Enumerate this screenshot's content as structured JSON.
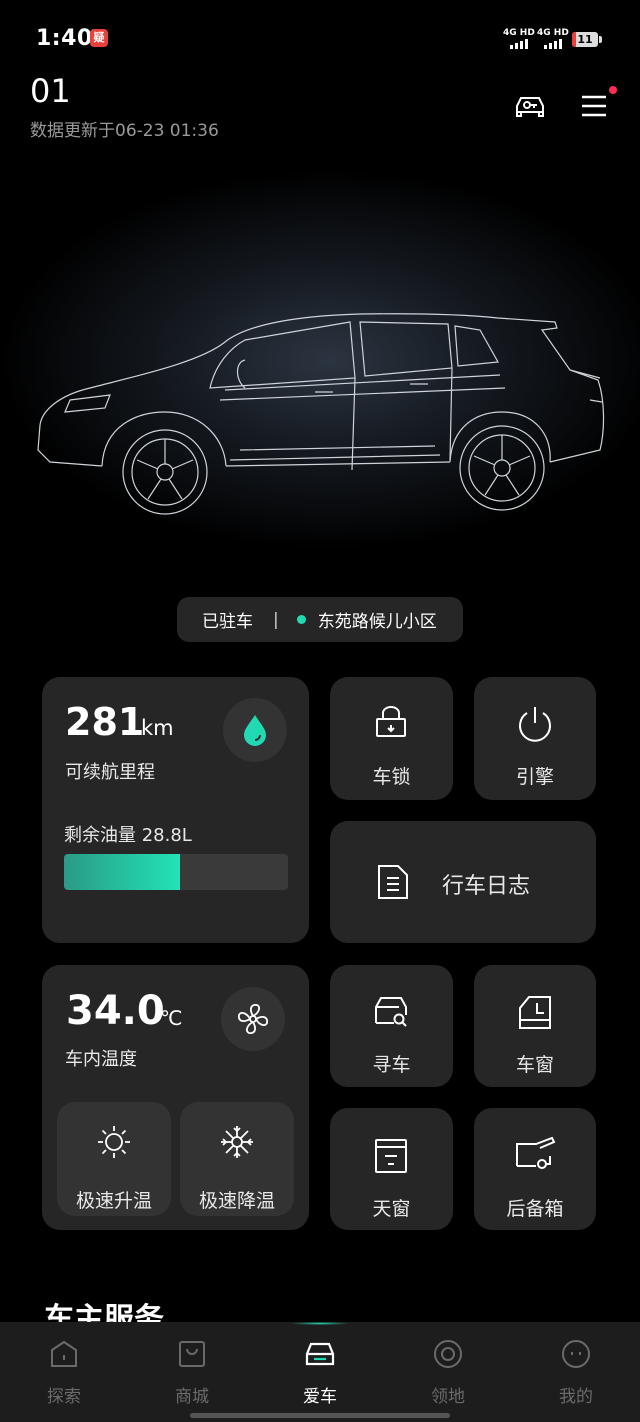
{
  "status_bar": {
    "time": "1:40",
    "app_badge": "疑",
    "network_1": "4G HD",
    "network_2": "4G HD",
    "battery": "11"
  },
  "header": {
    "car_name": "01",
    "update_text": "数据更新于06-23 01:36",
    "icons": [
      "car-key-icon",
      "menu-icon"
    ]
  },
  "parking": {
    "status": "已驻车",
    "separator": "|",
    "location": "东苑路候儿小区"
  },
  "range_card": {
    "value": "281",
    "unit": "km",
    "label": "可续航里程",
    "fuel_label": "剩余油量 28.8L",
    "fuel_fraction": 0.52,
    "icon": "fuel-drop-icon"
  },
  "controls": {
    "lock": "车锁",
    "engine": "引擎",
    "trip_log": "行车日志",
    "find_car": "寻车",
    "window": "车窗",
    "sunroof": "天窗",
    "trunk": "后备箱"
  },
  "climate_card": {
    "value": "34.0",
    "unit": "℃",
    "label": "车内温度",
    "heat_label": "极速升温",
    "cool_label": "极速降温",
    "icon": "fan-icon"
  },
  "section": {
    "title": "车主服务"
  },
  "nav": {
    "items": [
      {
        "label": "探索",
        "icon": "explore-icon"
      },
      {
        "label": "商城",
        "icon": "shop-icon"
      },
      {
        "label": "爱车",
        "icon": "car-icon"
      },
      {
        "label": "领地",
        "icon": "territory-icon"
      },
      {
        "label": "我的",
        "icon": "profile-icon"
      }
    ],
    "active_index": 2
  },
  "colors": {
    "accent": "#21d9b3",
    "card": "#262626",
    "background": "#000000",
    "notification": "#ff2d55"
  }
}
